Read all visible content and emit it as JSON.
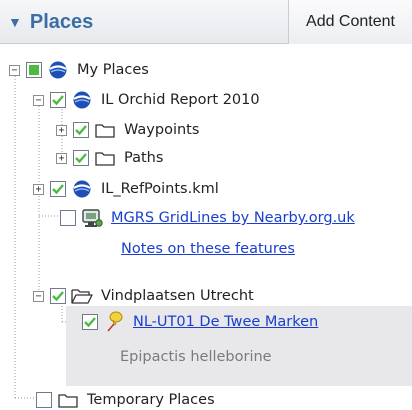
{
  "header": {
    "title": "Places",
    "add_content_label": "Add Content"
  },
  "tree": {
    "my_places": "My Places",
    "orchid_report": "IL Orchid Report 2010",
    "waypoints": "Waypoints",
    "paths": "Paths",
    "refpoints": "IL_RefPoints.kml",
    "mgrs_link": "MGRS GridLines by Nearby.org.uk",
    "notes_link": "Notes on these features",
    "vindplaatsen": "Vindplaatsen Utrecht",
    "placemark_link": "NL-UT01 De Twee Marken",
    "placemark_desc": "Epipactis helleborine",
    "temporary": "Temporary Places"
  },
  "colors": {
    "title": "#3a6ea5",
    "link": "#1a3fd0",
    "check": "#4cbb3f"
  }
}
